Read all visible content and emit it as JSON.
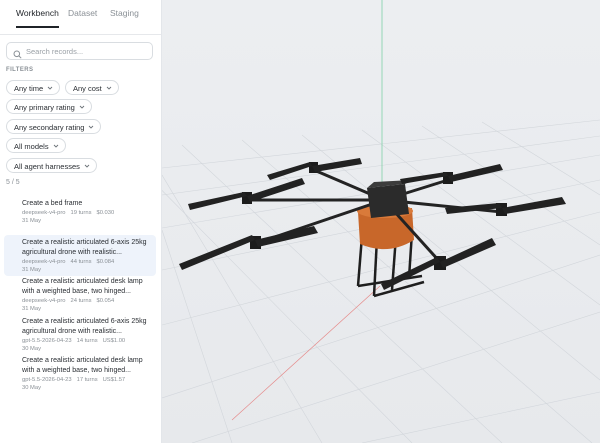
{
  "tabs": [
    {
      "label": "Workbench",
      "active": true
    },
    {
      "label": "Dataset",
      "active": false
    },
    {
      "label": "Staging",
      "active": false
    }
  ],
  "search": {
    "placeholder": "Search records..."
  },
  "filters": {
    "label": "FILTERS",
    "pills": [
      "Any time",
      "Any cost",
      "Any primary rating",
      "Any secondary rating",
      "All models",
      "All agent harnesses"
    ]
  },
  "record_count": "5 / 5",
  "records": [
    {
      "title": "Create a bed frame",
      "model": "deepseek-v4-pro",
      "turns": "19 turns",
      "cost": "$0.030",
      "date": "31 May",
      "selected": false
    },
    {
      "title": "Create a realistic articulated 6-axis 25kg agricultural drone with realistic...",
      "model": "deepseek-v4-pro",
      "turns": "44 turns",
      "cost": "$0.084",
      "date": "31 May",
      "selected": true
    },
    {
      "title": "Create a realistic articulated desk lamp with a weighted base, two hinged...",
      "model": "deepseek-v4-pro",
      "turns": "24 turns",
      "cost": "$0.054",
      "date": "31 May",
      "selected": false
    },
    {
      "title": "Create a realistic articulated 6-axis 25kg agricultural drone with realistic...",
      "model": "gpt-5.5-2026-04-23",
      "turns": "14 turns",
      "cost": "US$1.00",
      "date": "30 May",
      "selected": false
    },
    {
      "title": "Create a realistic articulated desk lamp with a weighted base, two hinged...",
      "model": "gpt-5.5-2026-04-23",
      "turns": "17 turns",
      "cost": "US$1.57",
      "date": "30 May",
      "selected": false
    }
  ],
  "colors": {
    "accent": "#1f2328",
    "selected_bg": "#eef3fb",
    "tank": "#c8672a",
    "frame": "#262626"
  }
}
